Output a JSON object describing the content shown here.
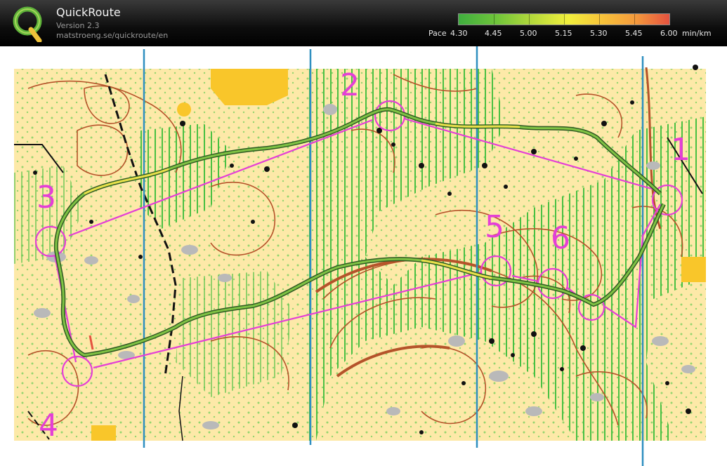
{
  "app": {
    "title": "QuickRoute",
    "version": "Version 2.3",
    "url": "matstroeng.se/quickroute/en"
  },
  "pace_scale": {
    "prefix": "Pace",
    "labels": [
      "4.30",
      "4.45",
      "5.00",
      "5.15",
      "5.30",
      "5.45",
      "6.00"
    ],
    "unit": "min/km",
    "min": 4.3,
    "max": 6.0,
    "colors": [
      "#3fae3f",
      "#6fc43a",
      "#b5d93b",
      "#f1ef3c",
      "#f7c33a",
      "#f49a3c",
      "#e5523f"
    ]
  },
  "map": {
    "controls": [
      {
        "label": "1"
      },
      {
        "label": "2"
      },
      {
        "label": "3"
      },
      {
        "label": "4"
      },
      {
        "label": "5"
      },
      {
        "label": "6"
      }
    ],
    "colors": {
      "terrain_yellow": "#fde9a8",
      "vegetation_green": "#3fc43f",
      "contour_brown": "#b5532a",
      "course_magenta": "#e43fd6",
      "meridian_blue": "#2f8fc0",
      "route_green": "#3a8a2a",
      "route_yellow": "#e8e04a"
    }
  }
}
